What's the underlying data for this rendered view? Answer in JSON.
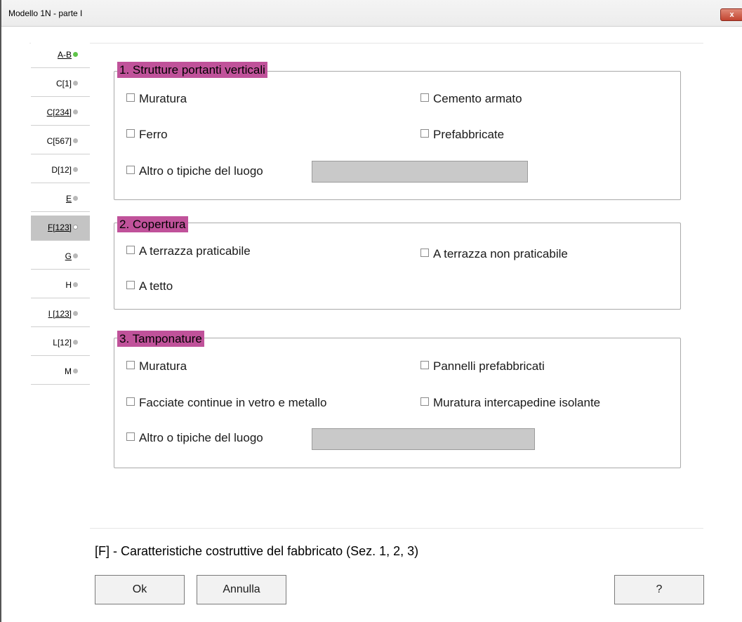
{
  "window": {
    "title": "Modello 1N  -   parte I",
    "close_label": "x"
  },
  "tabs": [
    {
      "label": "A-B",
      "status": "green"
    },
    {
      "label": "C[1]",
      "status": "gray"
    },
    {
      "label": "C[234]",
      "status": "gray"
    },
    {
      "label": "C[567]",
      "status": "gray"
    },
    {
      "label": "D[12]",
      "status": "gray"
    },
    {
      "label": "E",
      "status": "gray"
    },
    {
      "label": "F[123]",
      "status": "white",
      "active": true
    },
    {
      "label": "G",
      "status": "gray"
    },
    {
      "label": "H",
      "status": "gray"
    },
    {
      "label": "I [123]",
      "status": "gray"
    },
    {
      "label": "L[12]",
      "status": "gray"
    },
    {
      "label": "M",
      "status": "gray"
    }
  ],
  "sections": {
    "s1": {
      "title": "1. Strutture portanti verticali",
      "muratura": "Muratura",
      "cemento": "Cemento armato",
      "ferro": "Ferro",
      "prefabbricate": "Prefabbricate",
      "altro": "Altro o tipiche del luogo",
      "altro_value": ""
    },
    "s2": {
      "title": "2. Copertura",
      "terrazza_prat": "A terrazza praticabile",
      "terrazza_non": "A terrazza non praticabile",
      "tetto": "A tetto"
    },
    "s3": {
      "title": "3. Tamponature",
      "muratura": "Muratura",
      "pannelli": "Pannelli prefabbricati",
      "facciate": "Facciate continue in vetro e metallo",
      "intercapedine": "Muratura intercapedine isolante",
      "altro": "Altro o tipiche del luogo",
      "altro_value": ""
    }
  },
  "footer": {
    "hint": "[F] - Caratteristiche costruttive del fabbricato (Sez. 1, 2, 3)",
    "ok": "Ok",
    "cancel": "Annulla",
    "help": "?"
  },
  "colors": {
    "legend_bg": "#c0529a",
    "active_tab": "#c4c4c4",
    "dot_green": "#5fc44a"
  }
}
